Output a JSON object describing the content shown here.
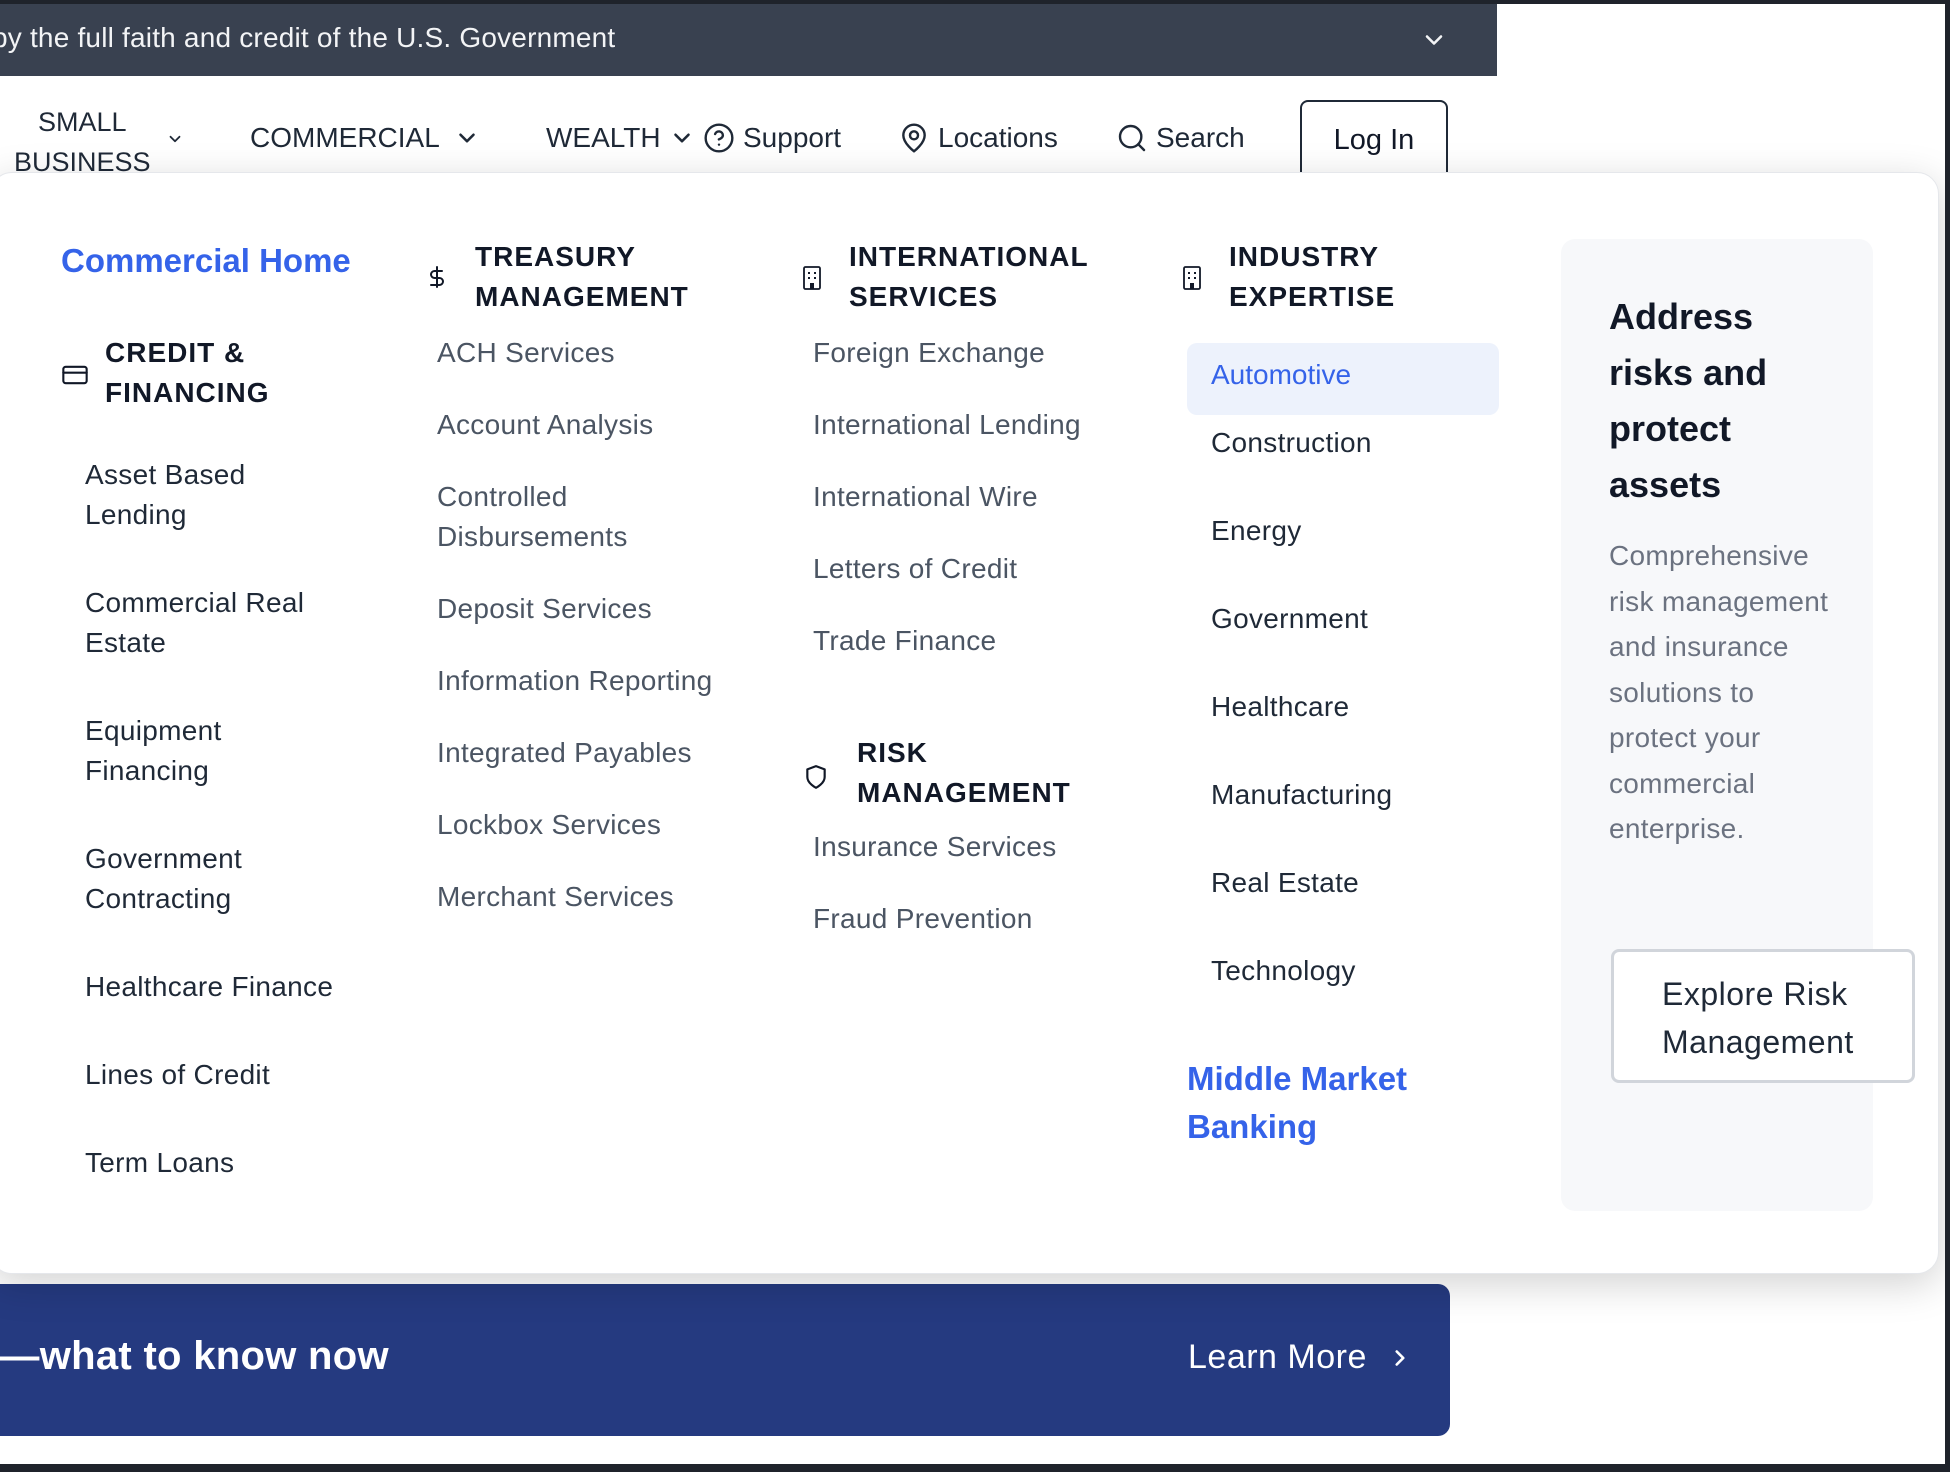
{
  "topbar": {
    "text": "by the full faith and credit of the U.S. Government"
  },
  "nav": {
    "small_business_line1": "SMALL",
    "small_business_line2": "BUSINESS",
    "commercial": "COMMERCIAL",
    "wealth": "WEALTH",
    "support": "Support",
    "locations": "Locations",
    "search": "Search",
    "login": "Log In"
  },
  "menu": {
    "commercial_home": "Commercial Home",
    "credit": {
      "heading_line1": "CREDIT &",
      "heading_line2": "FINANCING",
      "items": [
        [
          "Asset Based",
          "Lending"
        ],
        [
          "Commercial Real",
          "Estate"
        ],
        [
          "Equipment",
          "Financing"
        ],
        [
          "Government",
          "Contracting"
        ],
        "Healthcare Finance",
        "Lines of Credit",
        "Term Loans"
      ]
    },
    "treasury": {
      "heading_line1": "TREASURY",
      "heading_line2": "MANAGEMENT",
      "items": [
        "ACH Services",
        "Account Analysis",
        [
          "Controlled",
          "Disbursements"
        ],
        "Deposit Services",
        "Information Reporting",
        "Integrated Payables",
        "Lockbox Services",
        "Merchant Services"
      ]
    },
    "international": {
      "heading_line1": "INTERNATIONAL",
      "heading_line2": "SERVICES",
      "items": [
        "Foreign Exchange",
        "International Lending",
        "International Wire",
        "Letters of Credit",
        "Trade Finance"
      ]
    },
    "risk": {
      "heading_line1": "RISK",
      "heading_line2": "MANAGEMENT",
      "items": [
        "Insurance Services",
        "Fraud Prevention"
      ]
    },
    "industry": {
      "heading_line1": "INDUSTRY",
      "heading_line2": "EXPERTISE",
      "active": "Automotive",
      "items": [
        "Construction",
        "Energy",
        "Government",
        "Healthcare",
        "Manufacturing",
        "Real Estate",
        "Technology"
      ]
    },
    "middle_market_line1": "Middle Market",
    "middle_market_line2": "Banking",
    "promo": {
      "title": "Address risks and protect assets",
      "body": "Comprehensive risk management and insurance solutions to protect your commercial enterprise.",
      "button": "Explore Risk Management"
    }
  },
  "banner": {
    "text": "l—what to know now",
    "link": "Learn More"
  },
  "colors": {
    "topbar": "#394150",
    "accent": "#3563e9",
    "banner": "#253a80",
    "active_bg": "#edf2fc"
  }
}
